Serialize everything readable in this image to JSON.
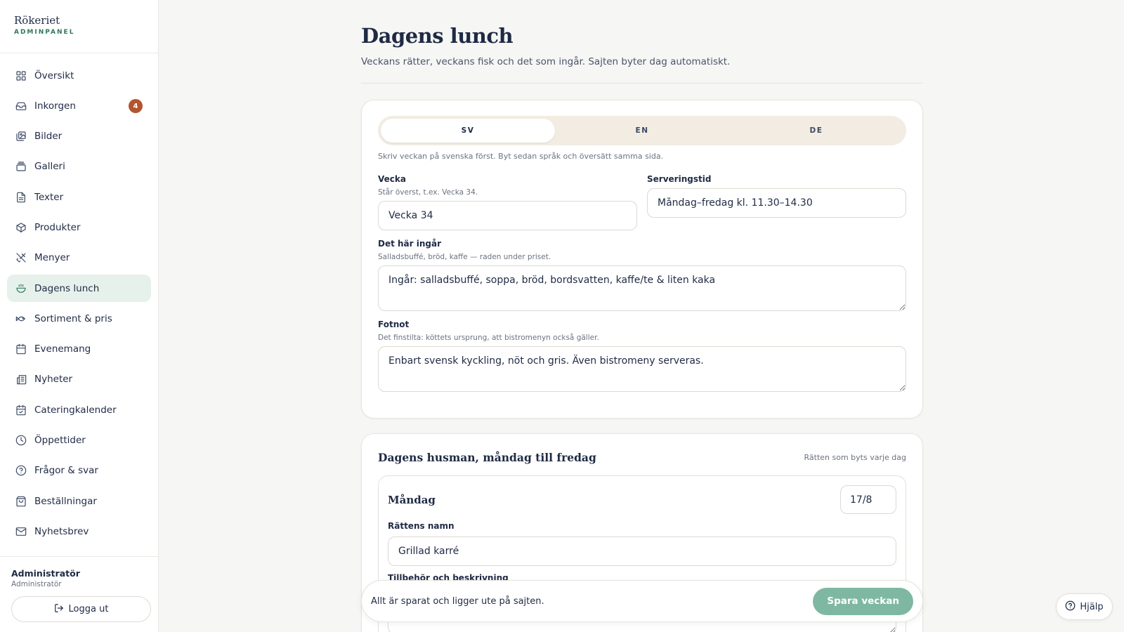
{
  "brand": {
    "name": "Rökeriet",
    "sub": "ADMINPANEL"
  },
  "sidebar": {
    "items": [
      {
        "label": "Översikt",
        "icon": "grid-icon"
      },
      {
        "label": "Inkorgen",
        "icon": "inbox-icon",
        "badge": "4"
      },
      {
        "label": "Bilder",
        "icon": "images-icon"
      },
      {
        "label": "Galleri",
        "icon": "gallery-icon"
      },
      {
        "label": "Texter",
        "icon": "document-icon"
      },
      {
        "label": "Produkter",
        "icon": "package-icon"
      },
      {
        "label": "Menyer",
        "icon": "utensils-icon"
      },
      {
        "label": "Dagens lunch",
        "icon": "bowl-icon",
        "active": true
      },
      {
        "label": "Sortiment & pris",
        "icon": "fish-icon"
      },
      {
        "label": "Evenemang",
        "icon": "calendar-icon"
      },
      {
        "label": "Nyheter",
        "icon": "newspaper-icon"
      },
      {
        "label": "Cateringkalender",
        "icon": "calendar-check-icon"
      },
      {
        "label": "Öppettider",
        "icon": "clock-icon"
      },
      {
        "label": "Frågor & svar",
        "icon": "help-circle-icon"
      },
      {
        "label": "Beställningar",
        "icon": "shopping-bag-icon"
      },
      {
        "label": "Nyhetsbrev",
        "icon": "mail-icon"
      }
    ]
  },
  "user": {
    "name": "Administratör",
    "role": "Administratör"
  },
  "logout_label": "Logga ut",
  "page": {
    "title": "Dagens lunch",
    "subtitle": "Veckans rätter, veckans fisk och det som ingår. Sajten byter dag automatiskt."
  },
  "lang_tabs": [
    {
      "label": "SV",
      "active": true
    },
    {
      "label": "EN"
    },
    {
      "label": "DE"
    }
  ],
  "lang_hint": "Skriv veckan på svenska först. Byt sedan språk och översätt samma sida.",
  "week": {
    "label": "Vecka",
    "help": "Står överst, t.ex. Vecka 34.",
    "value": "Vecka 34"
  },
  "serving": {
    "label": "Serveringstid",
    "value": "Måndag–fredag kl. 11.30–14.30"
  },
  "included": {
    "label": "Det här ingår",
    "help": "Salladsbuffé, bröd, kaffe — raden under priset.",
    "value": "Ingår: salladsbuffé, soppa, bröd, bordsvatten, kaffe/te & liten kaka"
  },
  "footnote": {
    "label": "Fotnot",
    "help": "Det finstilta: köttets ursprung, att bistromenyn också gäller.",
    "value": "Enbart svensk kyckling, nöt och gris. Även bistromeny serveras."
  },
  "husman": {
    "title": "Dagens husman, måndag till fredag",
    "note": "Rätten som byts varje dag",
    "day": {
      "name": "Måndag",
      "date": "17/8",
      "dish_label": "Rättens namn",
      "dish_value": "Grillad karré",
      "desc_label": "Tillbehör och beskrivning"
    }
  },
  "savebar": {
    "status": "Allt är sparat och ligger ute på sajten.",
    "button": "Spara veckan"
  },
  "help_label": "Hjälp",
  "colors": {
    "accent": "#2d7a5b",
    "active_bg": "#e6f1ec",
    "badge": "#b3552f",
    "save_button": "#7fb8a2",
    "tabs_bg": "#f2ece2"
  }
}
